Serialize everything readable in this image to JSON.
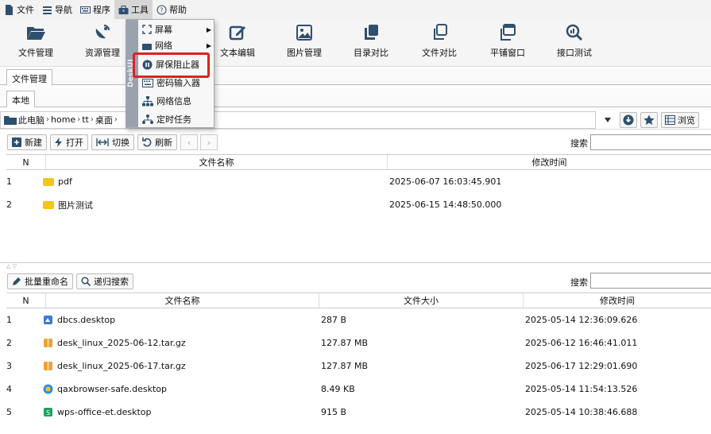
{
  "menubar": {
    "items": [
      {
        "label": "文件",
        "icon": "file-icon"
      },
      {
        "label": "导航",
        "icon": "menu-lines-icon"
      },
      {
        "label": "程序",
        "icon": "keyboard-icon"
      },
      {
        "label": "工具",
        "icon": "toolbox-icon"
      },
      {
        "label": "帮助",
        "icon": "help-circle-icon"
      }
    ]
  },
  "toolbar": {
    "items": [
      {
        "label": "文件管理",
        "icon": "folder-open-icon"
      },
      {
        "label": "资源管理",
        "icon": "satellite-dish-icon"
      },
      {
        "label": "文本编辑",
        "icon": "edit-icon"
      },
      {
        "label": "图片管理",
        "icon": "image-icon"
      },
      {
        "label": "目录对比",
        "icon": "copy-icon"
      },
      {
        "label": "文件对比",
        "icon": "clone-icon"
      },
      {
        "label": "平铺窗口",
        "icon": "window-tile-icon"
      },
      {
        "label": "接口测试",
        "icon": "magnify-chart-icon"
      }
    ]
  },
  "tools_menu": {
    "side_label": "DeskUI",
    "items": [
      {
        "label": "屏幕",
        "icon": "screen-corners-icon",
        "submenu": true
      },
      {
        "label": "网络",
        "icon": "network-icon",
        "submenu": true
      },
      {
        "label": "屏保阻止器",
        "icon": "pause-circle-icon",
        "submenu": false
      },
      {
        "label": "密码输入器",
        "icon": "keyboard-icon",
        "submenu": false
      },
      {
        "label": "网络信息",
        "icon": "sitemap-icon",
        "submenu": false
      },
      {
        "label": "定时任务",
        "icon": "schedule-tree-icon",
        "submenu": false
      }
    ]
  },
  "tabs": {
    "outer": "文件管理",
    "inner": "本地"
  },
  "path": {
    "crumbs": [
      "此电脑",
      "home",
      "tt",
      "桌面"
    ],
    "browse_label": "浏览"
  },
  "top_actions": {
    "new": "新建",
    "open": "打开",
    "switch": "切换",
    "refresh": "刷新",
    "search_label": "搜索"
  },
  "top_table": {
    "columns": [
      "N",
      "文件名称",
      "修改时间"
    ],
    "rows": [
      {
        "n": "1",
        "name": "pdf",
        "time": "2025-06-07 16:03:45.901"
      },
      {
        "n": "2",
        "name": "图片测试",
        "time": "2025-06-15 14:48:50.000"
      }
    ]
  },
  "bottom_actions": {
    "rename": "批量重命名",
    "recursive_search": "递归搜索",
    "search_label": "搜索"
  },
  "bottom_table": {
    "columns": [
      "N",
      "文件名称",
      "文件大小",
      "修改时间"
    ],
    "rows": [
      {
        "n": "1",
        "name": "dbcs.desktop",
        "size": "287 B",
        "time": "2025-05-14 12:36:09.626",
        "icon_color": "#3a7bd5"
      },
      {
        "n": "2",
        "name": "desk_linux_2025-06-12.tar.gz",
        "size": "127.87 MB",
        "time": "2025-06-12 16:46:41.011",
        "icon_color": "#f0a030"
      },
      {
        "n": "3",
        "name": "desk_linux_2025-06-17.tar.gz",
        "size": "127.87 MB",
        "time": "2025-06-17 12:29:01.690",
        "icon_color": "#f0a030"
      },
      {
        "n": "4",
        "name": "qaxbrowser-safe.desktop",
        "size": "8.49 KB",
        "time": "2025-05-14 11:54:13.526",
        "icon_color": "#2f8fe8"
      },
      {
        "n": "5",
        "name": "wps-office-et.desktop",
        "size": "915 B",
        "time": "2025-05-14 10:38:46.688",
        "icon_color": "#1aa260"
      }
    ]
  }
}
